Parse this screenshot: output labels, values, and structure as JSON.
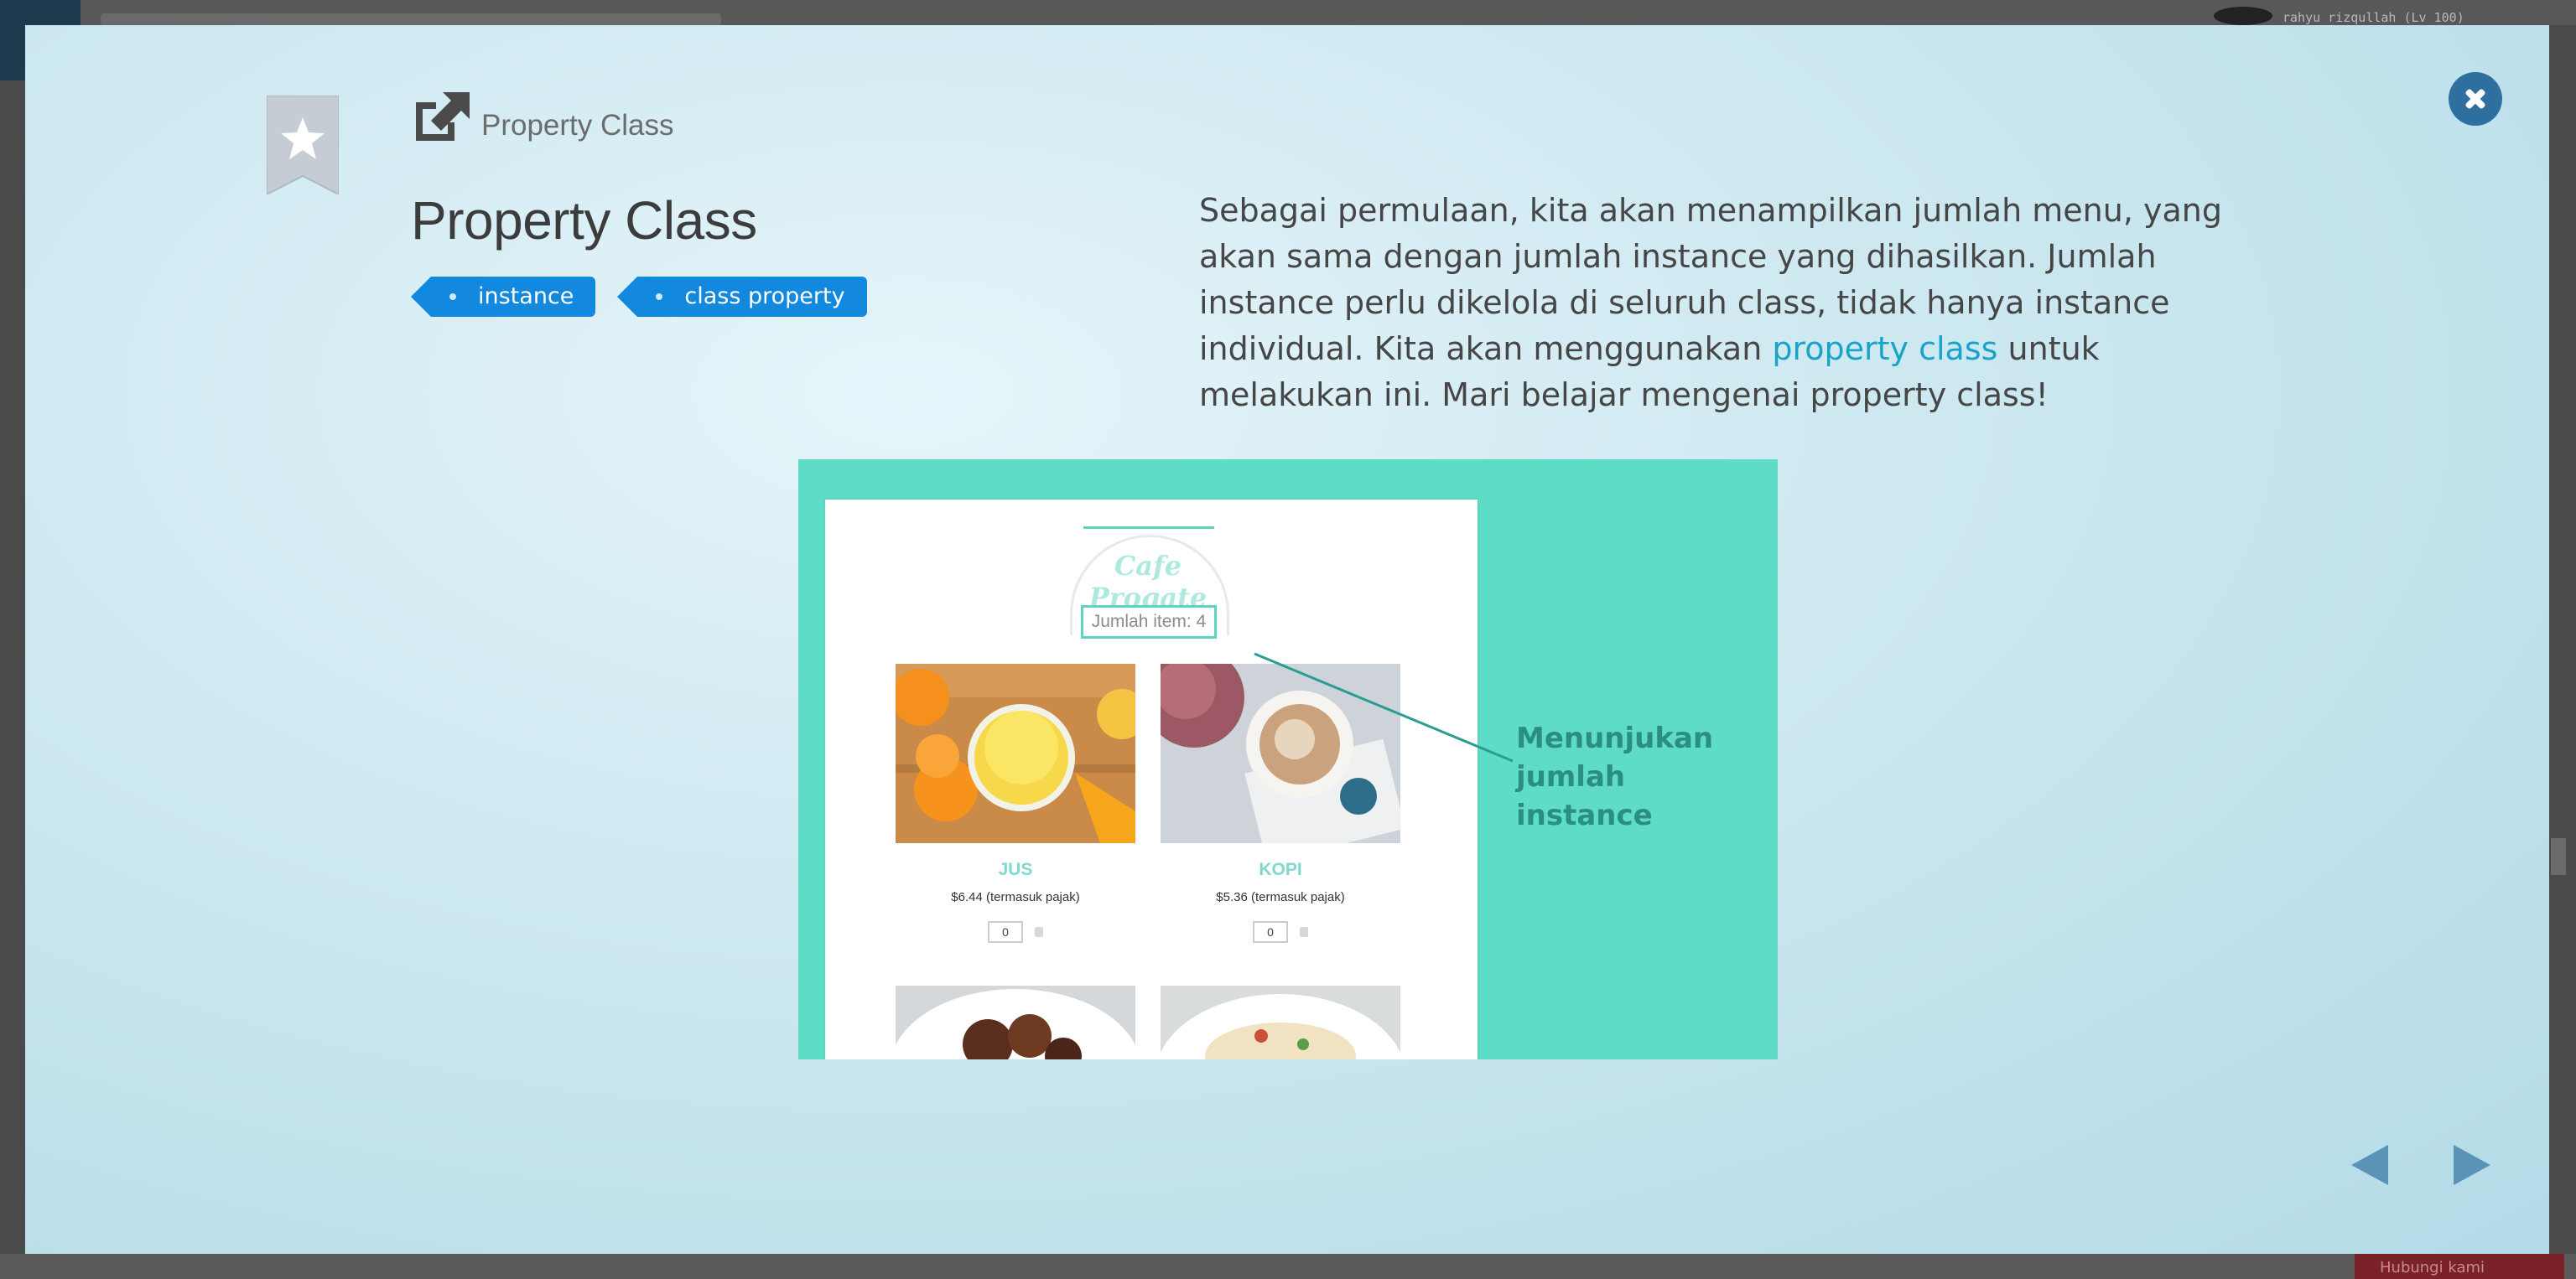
{
  "background": {
    "username": "rahyu rizqullah (Lv 100)",
    "bottom_button": "Hubungi kami"
  },
  "modal": {
    "subtitle": "Property Class",
    "title": "Property Class",
    "tags": [
      "instance",
      "class property"
    ],
    "description": {
      "before_link": "Sebagai permulaan, kita akan menampilkan jumlah menu, yang akan sama dengan jumlah instance yang dihasilkan. Jumlah instance perlu dikelola di seluruh class, tidak hanya instance individual. Kita akan menggunakan ",
      "link": "property class",
      "after_link": " untuk melakukan ini. Mari belajar mengenai property class!"
    },
    "icons": {
      "bookmark": "bookmark-star-icon",
      "external": "external-link-icon",
      "close": "close-icon",
      "prev": "prev-arrow-icon",
      "next": "next-arrow-icon"
    },
    "colors": {
      "tag": "#1388df",
      "link": "#1aa3c9",
      "close": "#2f6f9f",
      "illustration_bg": "#5edcc8"
    }
  },
  "illustration": {
    "cafe_name": "Cafe Progate",
    "counter": "Jumlah item: 4",
    "callout": "Menunjukan jumlah instance",
    "menu": [
      {
        "name": "JUS",
        "price": "$6.44 (termasuk pajak)",
        "qty": "0"
      },
      {
        "name": "KOPI",
        "price": "$5.36 (termasuk pajak)",
        "qty": "0"
      }
    ]
  }
}
